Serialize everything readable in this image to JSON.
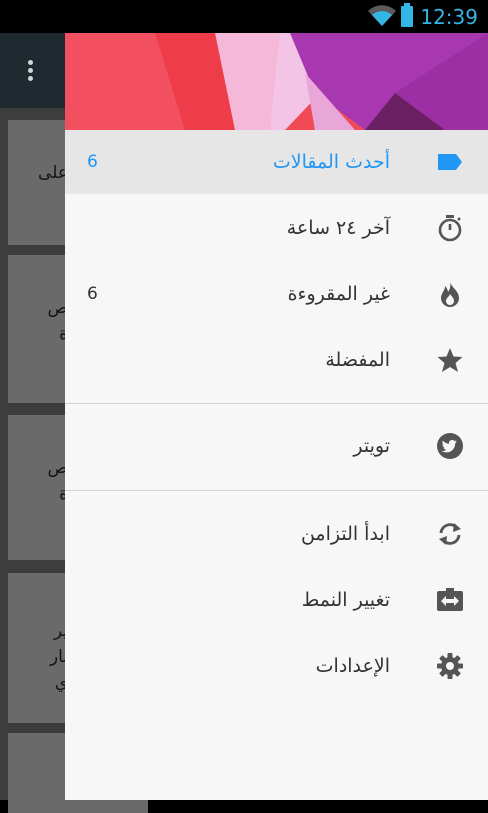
{
  "status_bar": {
    "time": "12:39",
    "wifi_icon": "wifi-icon",
    "battery_icon": "battery-icon"
  },
  "background_app": {
    "snippets": [
      "على",
      "ص\nة",
      "ص\nة",
      "ير\nبار\nي"
    ]
  },
  "drawer": {
    "primary_items": [
      {
        "label": "أحدث المقالات",
        "count": "6",
        "icon": "label-icon"
      },
      {
        "label": "آخر ٢٤ ساعة",
        "count": "",
        "icon": "stopwatch-icon"
      },
      {
        "label": "غير المقروءة",
        "count": "6",
        "icon": "flame-icon"
      },
      {
        "label": "المفضلة",
        "count": "",
        "icon": "star-icon"
      }
    ],
    "social_items": [
      {
        "label": "تويتر",
        "icon": "twitter-icon"
      }
    ],
    "action_items": [
      {
        "label": "ابدأ التزامن",
        "icon": "sync-icon"
      },
      {
        "label": "تغيير النمط",
        "icon": "toggle-theme-icon"
      },
      {
        "label": "الإعدادات",
        "icon": "gear-icon"
      }
    ]
  },
  "colors": {
    "accent": "#2196f3",
    "status_text": "#33b5e5",
    "icon": "#555555"
  }
}
